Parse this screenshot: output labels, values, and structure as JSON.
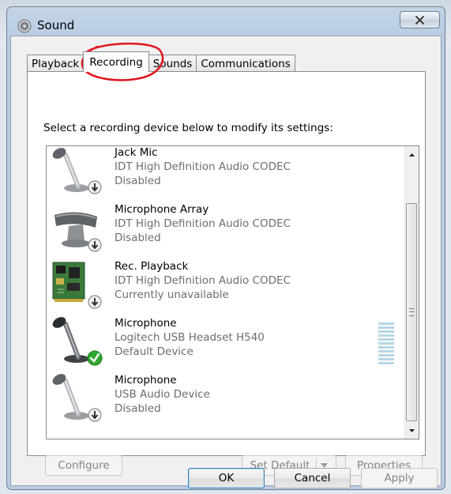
{
  "window": {
    "title": "Sound"
  },
  "tabs": [
    {
      "label": "Playback",
      "active": false
    },
    {
      "label": "Recording",
      "active": true
    },
    {
      "label": "Sounds",
      "active": false
    },
    {
      "label": "Communications",
      "active": false
    }
  ],
  "instruction": "Select a recording device below to modify its settings:",
  "devices": [
    {
      "name": "Jack Mic",
      "driver": "IDT High Definition Audio CODEC",
      "status": "Disabled",
      "icon": "microphone-stand-icon",
      "badge": "disabled-arrow-badge"
    },
    {
      "name": "Microphone Array",
      "driver": "IDT High Definition Audio CODEC",
      "status": "Disabled",
      "icon": "microphone-array-icon",
      "badge": "disabled-arrow-badge"
    },
    {
      "name": "Rec. Playback",
      "driver": "IDT High Definition Audio CODEC",
      "status": "Currently unavailable",
      "icon": "sound-card-icon",
      "badge": "disabled-arrow-badge"
    },
    {
      "name": "Microphone",
      "driver": "Logitech USB Headset H540",
      "status": "Default Device",
      "icon": "microphone-stand-icon",
      "badge": "default-check-badge"
    },
    {
      "name": "Microphone",
      "driver": "USB Audio Device",
      "status": "Disabled",
      "icon": "microphone-stand-icon",
      "badge": "disabled-arrow-badge"
    }
  ],
  "buttons": {
    "configure": "Configure",
    "set_default": "Set Default",
    "properties": "Properties",
    "ok": "OK",
    "cancel": "Cancel",
    "apply": "Apply"
  },
  "colors": {
    "annotation": "#e0161c",
    "check_green": "#2fa82f",
    "meter": "#b7d7e6"
  }
}
